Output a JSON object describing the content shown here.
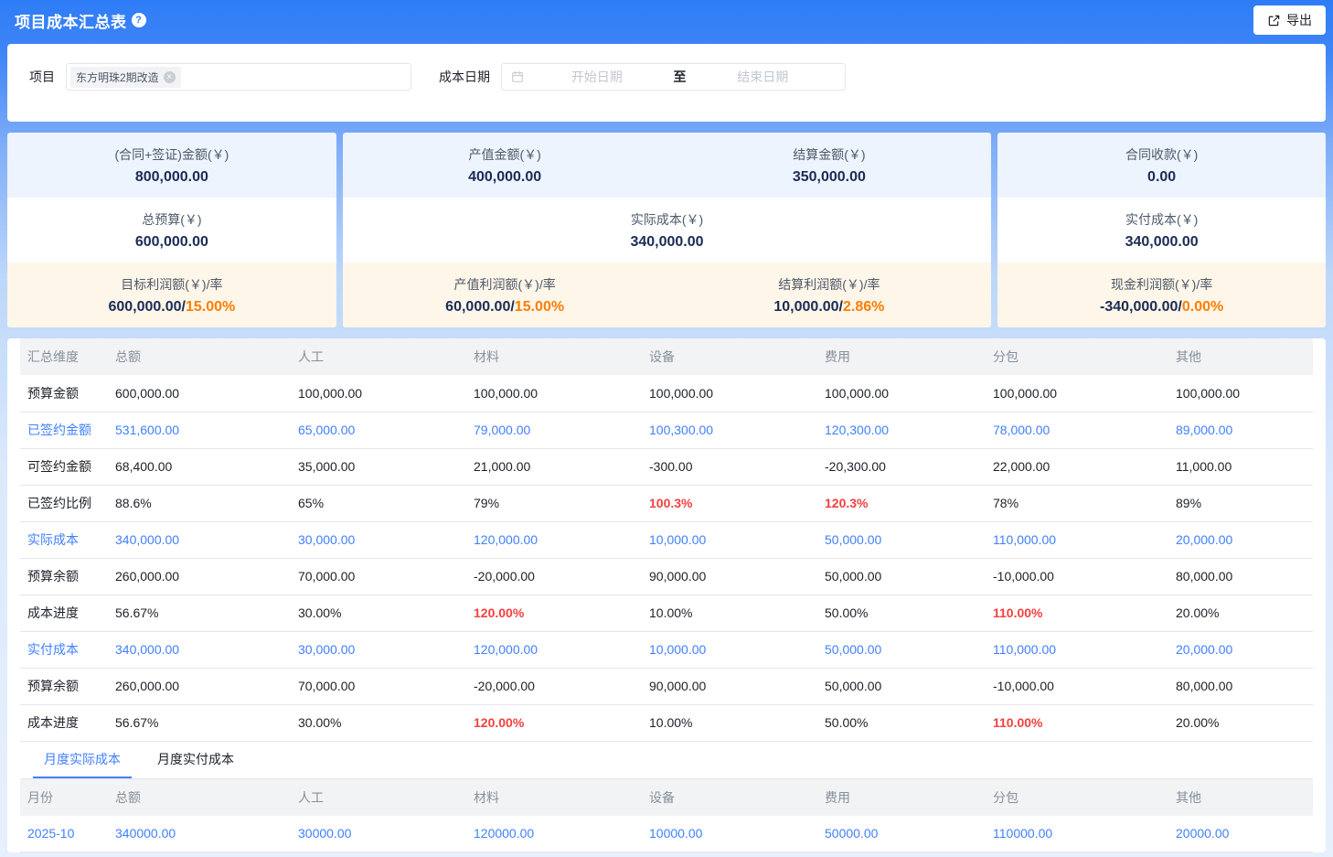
{
  "colors": {
    "accent_blue": "#2e7cf6",
    "link_blue": "#4080ff",
    "alert_red": "#f53f3f",
    "warn_orange": "#ff7d00",
    "value_navy": "#1b2b55"
  },
  "header": {
    "title": "项目成本汇总表",
    "help_glyph": "?",
    "export_label": "导出"
  },
  "filters": {
    "project_label": "项目",
    "project_tag": "东方明珠2期改造",
    "tag_close_glyph": "×",
    "date_label": "成本日期",
    "start_placeholder": "开始日期",
    "separator": "至",
    "end_placeholder": "结束日期"
  },
  "summary_cards": [
    {
      "flex": "360",
      "sections": [
        {
          "bg": "blue",
          "cells": [
            {
              "label": "(合同+签证)金额(￥)",
              "value": "800,000.00"
            }
          ]
        },
        {
          "bg": "white",
          "cells": [
            {
              "label": "总预算(￥)",
              "value": "600,000.00"
            }
          ]
        },
        {
          "bg": "cream",
          "cells": [
            {
              "label": "目标利润额(￥)/率",
              "value": "600,000.00",
              "rate": "15.00%"
            }
          ]
        }
      ]
    },
    {
      "flex": "710",
      "sections": [
        {
          "bg": "blue",
          "cells": [
            {
              "label": "产值金额(￥)",
              "value": "400,000.00"
            },
            {
              "label": "结算金额(￥)",
              "value": "350,000.00"
            }
          ]
        },
        {
          "bg": "white",
          "cells": [
            {
              "label": "实际成本(￥)",
              "value": "340,000.00"
            }
          ]
        },
        {
          "bg": "cream",
          "cells": [
            {
              "label": "产值利润额(￥)/率",
              "value": "60,000.00",
              "rate": "15.00%"
            },
            {
              "label": "结算利润额(￥)/率",
              "value": "10,000.00",
              "rate": "2.86%"
            }
          ]
        }
      ]
    },
    {
      "flex": "359",
      "sections": [
        {
          "bg": "blue",
          "cells": [
            {
              "label": "合同收款(￥)",
              "value": "0.00"
            }
          ]
        },
        {
          "bg": "white",
          "cells": [
            {
              "label": "实付成本(￥)",
              "value": "340,000.00"
            }
          ]
        },
        {
          "bg": "cream",
          "cells": [
            {
              "label": "现金利润额(￥)/率",
              "value": "-340,000.00",
              "rate": "0.00%"
            }
          ]
        }
      ]
    }
  ],
  "main_table": {
    "columns": [
      "汇总维度",
      "总额",
      "人工",
      "材料",
      "设备",
      "费用",
      "分包",
      "其他"
    ],
    "rows": [
      {
        "label": "预算金额",
        "style": "normal",
        "cells": [
          "600,000.00",
          "100,000.00",
          "100,000.00",
          "100,000.00",
          "100,000.00",
          "100,000.00",
          "100,000.00"
        ]
      },
      {
        "label": "已签约金额",
        "style": "blue",
        "cells": [
          "531,600.00",
          "65,000.00",
          "79,000.00",
          "100,300.00",
          "120,300.00",
          "78,000.00",
          "89,000.00"
        ]
      },
      {
        "label": "可签约金额",
        "style": "normal",
        "cells": [
          "68,400.00",
          "35,000.00",
          "21,000.00",
          "-300.00",
          "-20,300.00",
          "22,000.00",
          "11,000.00"
        ]
      },
      {
        "label": "已签约比例",
        "style": "normal",
        "cells": [
          "88.6%",
          "65%",
          "79%",
          {
            "t": "100.3%",
            "s": "red"
          },
          {
            "t": "120.3%",
            "s": "red"
          },
          "78%",
          "89%"
        ]
      },
      {
        "label": "实际成本",
        "style": "blue",
        "cells": [
          "340,000.00",
          "30,000.00",
          "120,000.00",
          "10,000.00",
          "50,000.00",
          "110,000.00",
          "20,000.00"
        ]
      },
      {
        "label": "预算余额",
        "style": "normal",
        "cells": [
          "260,000.00",
          "70,000.00",
          "-20,000.00",
          "90,000.00",
          "50,000.00",
          "-10,000.00",
          "80,000.00"
        ]
      },
      {
        "label": "成本进度",
        "style": "normal",
        "cells": [
          "56.67%",
          "30.00%",
          {
            "t": "120.00%",
            "s": "red"
          },
          "10.00%",
          "50.00%",
          {
            "t": "110.00%",
            "s": "red"
          },
          "20.00%"
        ]
      },
      {
        "label": "实付成本",
        "style": "blue",
        "cells": [
          "340,000.00",
          "30,000.00",
          "120,000.00",
          "10,000.00",
          "50,000.00",
          "110,000.00",
          "20,000.00"
        ]
      },
      {
        "label": "预算余额",
        "style": "normal",
        "cells": [
          "260,000.00",
          "70,000.00",
          "-20,000.00",
          "90,000.00",
          "50,000.00",
          "-10,000.00",
          "80,000.00"
        ]
      },
      {
        "label": "成本进度",
        "style": "normal",
        "cells": [
          "56.67%",
          "30.00%",
          {
            "t": "120.00%",
            "s": "red"
          },
          "10.00%",
          "50.00%",
          {
            "t": "110.00%",
            "s": "red"
          },
          "20.00%"
        ]
      }
    ]
  },
  "tabs": [
    {
      "label": "月度实际成本",
      "active": true
    },
    {
      "label": "月度实付成本",
      "active": false
    }
  ],
  "monthly_table": {
    "columns": [
      "月份",
      "总额",
      "人工",
      "材料",
      "设备",
      "费用",
      "分包",
      "其他"
    ],
    "rows": [
      {
        "label": "2025-10",
        "style": "blue",
        "cells": [
          "340000.00",
          "30000.00",
          "120000.00",
          "10000.00",
          "50000.00",
          "110000.00",
          "20000.00"
        ]
      }
    ]
  }
}
